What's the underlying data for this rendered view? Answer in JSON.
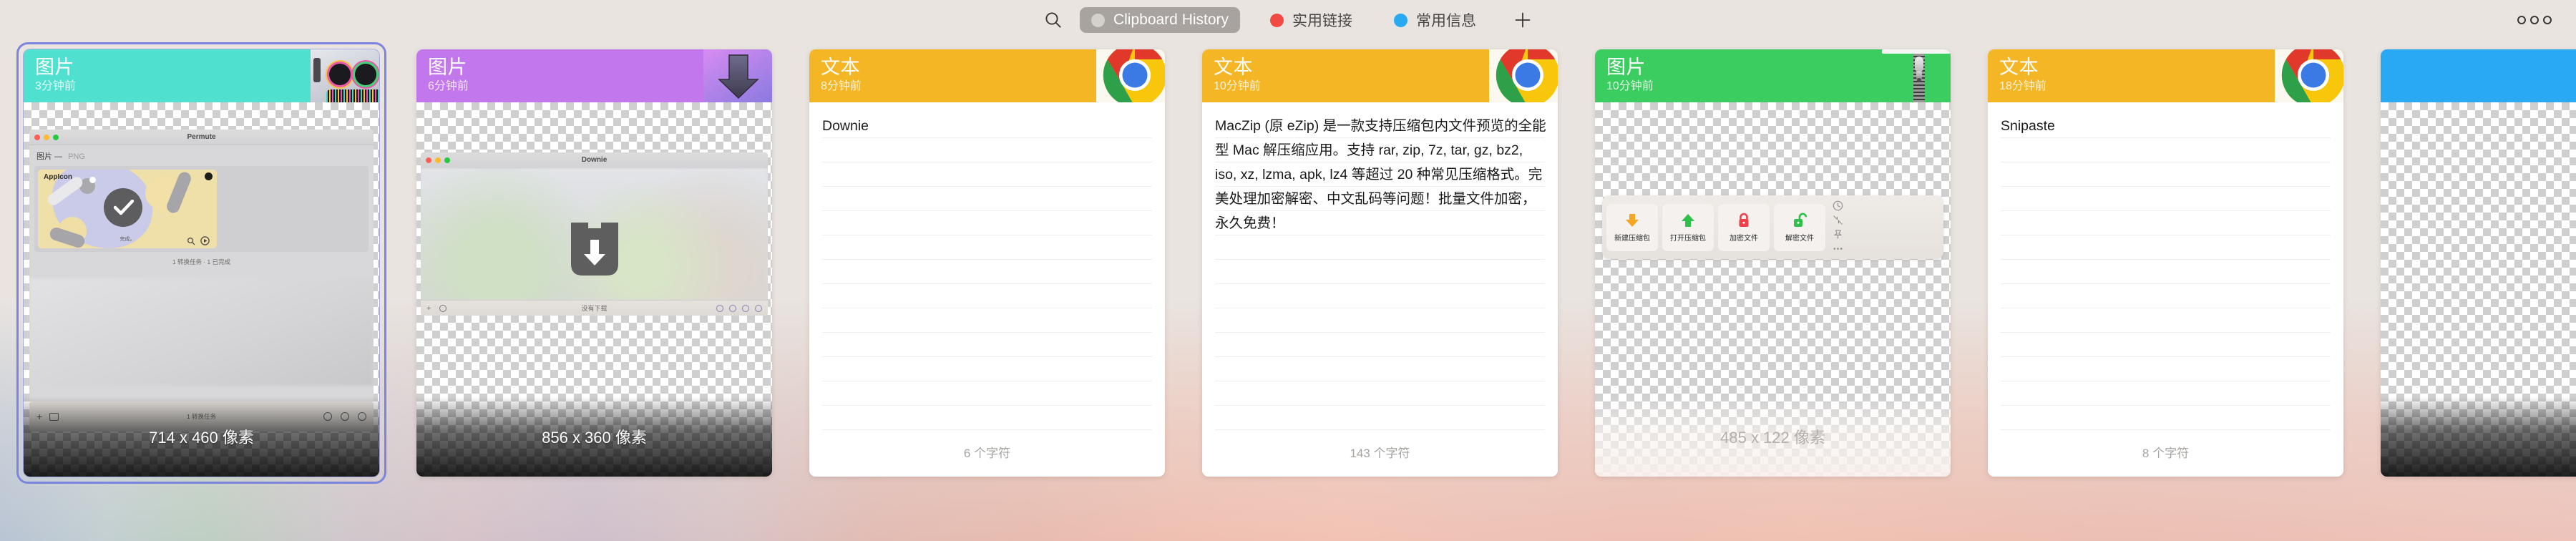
{
  "app": {
    "background_color": "#e9e4e0"
  },
  "toolbar": {
    "search_icon": "search-icon",
    "add_icon": "plus-icon",
    "more_icon": "more-options-icon",
    "tabs": [
      {
        "id": "clipboard-history",
        "label": "Clipboard History",
        "dot_color": "#d4d0cc",
        "active": true
      },
      {
        "id": "useful-links",
        "label": "实用链接",
        "dot_color": "#f04a42",
        "active": false
      },
      {
        "id": "common-info",
        "label": "常用信息",
        "dot_color": "#29a9f1",
        "active": false
      }
    ],
    "active_tab_background": "#a8a39e"
  },
  "cards": [
    {
      "id": "card-permute-image",
      "kind": "图片",
      "time": "3分钟前",
      "header_color": "#4fe0d0",
      "selected": true,
      "type": "image",
      "dimensions": "714 x 460 像素",
      "source_icon": "permute-app-icon",
      "preview": {
        "window_title": "Permute",
        "subtitle_left": "图片 —",
        "subtitle_right": "PNG",
        "item_name": "AppIcon",
        "item_status": "完成。",
        "footer_text": "1 转换任务 · 1 已完成",
        "bottom_bar_text": "1 转换任务"
      }
    },
    {
      "id": "card-downie-image",
      "kind": "图片",
      "time": "6分钟前",
      "header_color": "#c377ec",
      "selected": false,
      "type": "image",
      "dimensions": "856 x 360 像素",
      "source_icon": "downie-app-icon",
      "preview": {
        "window_title": "Downie",
        "footer_text": "没有下载"
      }
    },
    {
      "id": "card-downie-text",
      "kind": "文本",
      "time": "8分钟前",
      "header_color": "#f5b625",
      "selected": false,
      "type": "text",
      "text": "Downie",
      "char_count": "6 个字符",
      "source_icon": "chrome-icon"
    },
    {
      "id": "card-maczip-text",
      "kind": "文本",
      "time": "10分钟前",
      "header_color": "#f5b625",
      "selected": false,
      "type": "text",
      "text": "MacZip (原 eZip) 是一款支持压缩包内文件预览的全能型 Mac 解压缩应用。支持 rar, zip, 7z, tar, gz, bz2, iso, xz, lzma, apk, lz4 等超过 20 种常见压缩格式。完美处理加密解密、中文乱码等问题！批量文件加密，永久免费！",
      "char_count": "143 个字符",
      "source_icon": "chrome-icon"
    },
    {
      "id": "card-maczip-image",
      "kind": "图片",
      "time": "10分钟前",
      "header_color": "#3ccd60",
      "selected": false,
      "type": "image",
      "dimensions": "485 x 122 像素",
      "source_icon": "maczip-zipper-icon",
      "preview": {
        "buttons": [
          {
            "label": "新建压缩包",
            "icon": "download-arrow-icon",
            "color": "#f5a623"
          },
          {
            "label": "打开压缩包",
            "icon": "upload-arrow-icon",
            "color": "#2fc04a"
          },
          {
            "label": "加密文件",
            "icon": "lock-closed-icon",
            "color": "#f0404a"
          },
          {
            "label": "解密文件",
            "icon": "lock-open-icon",
            "color": "#2fc04a"
          }
        ],
        "side_icons": [
          "clock-icon",
          "collapse-icon",
          "pin-icon",
          "ellipsis-icon"
        ]
      }
    },
    {
      "id": "card-snipaste-text",
      "kind": "文本",
      "time": "18分钟前",
      "header_color": "#f5b625",
      "selected": false,
      "type": "text",
      "text": "Snipaste",
      "char_count": "8 个字符",
      "source_icon": "chrome-icon"
    },
    {
      "id": "card-partial",
      "kind": "",
      "time": "",
      "header_color": "#29a9f1",
      "selected": false,
      "type": "image",
      "dimensions": "",
      "source_icon": "",
      "partial": true
    }
  ]
}
